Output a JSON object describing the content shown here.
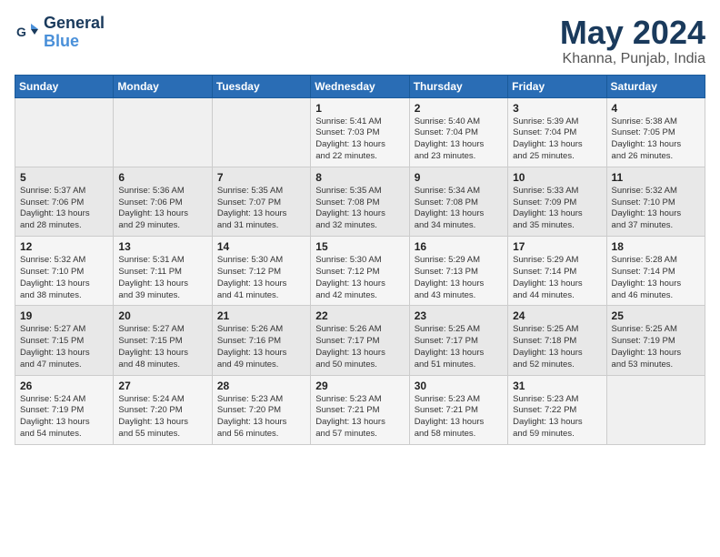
{
  "header": {
    "logo_line1": "General",
    "logo_line2": "Blue",
    "title": "May 2024",
    "location": "Khanna, Punjab, India"
  },
  "weekdays": [
    "Sunday",
    "Monday",
    "Tuesday",
    "Wednesday",
    "Thursday",
    "Friday",
    "Saturday"
  ],
  "weeks": [
    [
      {
        "day": "",
        "info": ""
      },
      {
        "day": "",
        "info": ""
      },
      {
        "day": "",
        "info": ""
      },
      {
        "day": "1",
        "info": "Sunrise: 5:41 AM\nSunset: 7:03 PM\nDaylight: 13 hours\nand 22 minutes."
      },
      {
        "day": "2",
        "info": "Sunrise: 5:40 AM\nSunset: 7:04 PM\nDaylight: 13 hours\nand 23 minutes."
      },
      {
        "day": "3",
        "info": "Sunrise: 5:39 AM\nSunset: 7:04 PM\nDaylight: 13 hours\nand 25 minutes."
      },
      {
        "day": "4",
        "info": "Sunrise: 5:38 AM\nSunset: 7:05 PM\nDaylight: 13 hours\nand 26 minutes."
      }
    ],
    [
      {
        "day": "5",
        "info": "Sunrise: 5:37 AM\nSunset: 7:06 PM\nDaylight: 13 hours\nand 28 minutes."
      },
      {
        "day": "6",
        "info": "Sunrise: 5:36 AM\nSunset: 7:06 PM\nDaylight: 13 hours\nand 29 minutes."
      },
      {
        "day": "7",
        "info": "Sunrise: 5:35 AM\nSunset: 7:07 PM\nDaylight: 13 hours\nand 31 minutes."
      },
      {
        "day": "8",
        "info": "Sunrise: 5:35 AM\nSunset: 7:08 PM\nDaylight: 13 hours\nand 32 minutes."
      },
      {
        "day": "9",
        "info": "Sunrise: 5:34 AM\nSunset: 7:08 PM\nDaylight: 13 hours\nand 34 minutes."
      },
      {
        "day": "10",
        "info": "Sunrise: 5:33 AM\nSunset: 7:09 PM\nDaylight: 13 hours\nand 35 minutes."
      },
      {
        "day": "11",
        "info": "Sunrise: 5:32 AM\nSunset: 7:10 PM\nDaylight: 13 hours\nand 37 minutes."
      }
    ],
    [
      {
        "day": "12",
        "info": "Sunrise: 5:32 AM\nSunset: 7:10 PM\nDaylight: 13 hours\nand 38 minutes."
      },
      {
        "day": "13",
        "info": "Sunrise: 5:31 AM\nSunset: 7:11 PM\nDaylight: 13 hours\nand 39 minutes."
      },
      {
        "day": "14",
        "info": "Sunrise: 5:30 AM\nSunset: 7:12 PM\nDaylight: 13 hours\nand 41 minutes."
      },
      {
        "day": "15",
        "info": "Sunrise: 5:30 AM\nSunset: 7:12 PM\nDaylight: 13 hours\nand 42 minutes."
      },
      {
        "day": "16",
        "info": "Sunrise: 5:29 AM\nSunset: 7:13 PM\nDaylight: 13 hours\nand 43 minutes."
      },
      {
        "day": "17",
        "info": "Sunrise: 5:29 AM\nSunset: 7:14 PM\nDaylight: 13 hours\nand 44 minutes."
      },
      {
        "day": "18",
        "info": "Sunrise: 5:28 AM\nSunset: 7:14 PM\nDaylight: 13 hours\nand 46 minutes."
      }
    ],
    [
      {
        "day": "19",
        "info": "Sunrise: 5:27 AM\nSunset: 7:15 PM\nDaylight: 13 hours\nand 47 minutes."
      },
      {
        "day": "20",
        "info": "Sunrise: 5:27 AM\nSunset: 7:15 PM\nDaylight: 13 hours\nand 48 minutes."
      },
      {
        "day": "21",
        "info": "Sunrise: 5:26 AM\nSunset: 7:16 PM\nDaylight: 13 hours\nand 49 minutes."
      },
      {
        "day": "22",
        "info": "Sunrise: 5:26 AM\nSunset: 7:17 PM\nDaylight: 13 hours\nand 50 minutes."
      },
      {
        "day": "23",
        "info": "Sunrise: 5:25 AM\nSunset: 7:17 PM\nDaylight: 13 hours\nand 51 minutes."
      },
      {
        "day": "24",
        "info": "Sunrise: 5:25 AM\nSunset: 7:18 PM\nDaylight: 13 hours\nand 52 minutes."
      },
      {
        "day": "25",
        "info": "Sunrise: 5:25 AM\nSunset: 7:19 PM\nDaylight: 13 hours\nand 53 minutes."
      }
    ],
    [
      {
        "day": "26",
        "info": "Sunrise: 5:24 AM\nSunset: 7:19 PM\nDaylight: 13 hours\nand 54 minutes."
      },
      {
        "day": "27",
        "info": "Sunrise: 5:24 AM\nSunset: 7:20 PM\nDaylight: 13 hours\nand 55 minutes."
      },
      {
        "day": "28",
        "info": "Sunrise: 5:23 AM\nSunset: 7:20 PM\nDaylight: 13 hours\nand 56 minutes."
      },
      {
        "day": "29",
        "info": "Sunrise: 5:23 AM\nSunset: 7:21 PM\nDaylight: 13 hours\nand 57 minutes."
      },
      {
        "day": "30",
        "info": "Sunrise: 5:23 AM\nSunset: 7:21 PM\nDaylight: 13 hours\nand 58 minutes."
      },
      {
        "day": "31",
        "info": "Sunrise: 5:23 AM\nSunset: 7:22 PM\nDaylight: 13 hours\nand 59 minutes."
      },
      {
        "day": "",
        "info": ""
      }
    ]
  ]
}
